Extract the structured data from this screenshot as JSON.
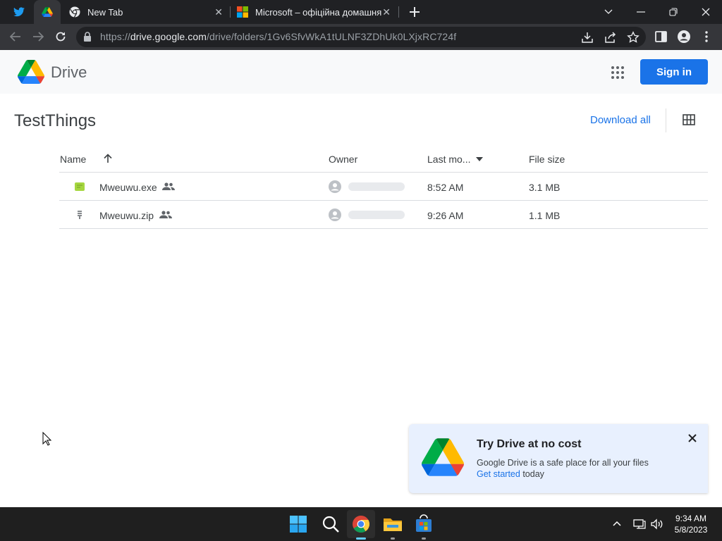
{
  "browser": {
    "tabs": [
      {
        "type": "pinned",
        "icon": "twitter-icon",
        "active": false
      },
      {
        "type": "pinned",
        "icon": "google-drive-icon",
        "active": true
      },
      {
        "type": "normal",
        "icon": "chrome-icon",
        "label": "New Tab",
        "active": false
      },
      {
        "type": "normal",
        "icon": "microsoft-logo-icon",
        "label": "Microsoft – офіційна домашня с",
        "active": false
      }
    ],
    "url_prefix": "https://",
    "url_domain": "drive.google.com",
    "url_path": "/drive/folders/1Gv6SfvWkA1tULNF3ZDhUk0LXjxRC724f",
    "close_glyph": "✕"
  },
  "drive": {
    "app_name": "Drive",
    "sign_in_label": "Sign in",
    "folder_title": "TestThings",
    "download_all_label": "Download all",
    "columns": {
      "name": "Name",
      "owner": "Owner",
      "modified": "Last mo...",
      "size": "File size"
    },
    "files": [
      {
        "name": "Mweuwu.exe",
        "icon": "executable-file-icon",
        "modified": "8:52 AM",
        "size": "3.1 MB",
        "shared": true
      },
      {
        "name": "Mweuwu.zip",
        "icon": "zip-file-icon",
        "modified": "9:26 AM",
        "size": "1.1 MB",
        "shared": true
      }
    ],
    "promo": {
      "title": "Try Drive at no cost",
      "description": "Google Drive is a safe place for all your files",
      "link_text": "Get started",
      "link_suffix": " today",
      "close_glyph": "✕"
    }
  },
  "taskbar": {
    "time": "9:34 AM",
    "date": "5/8/2023"
  },
  "colors": {
    "accent": "#1a73e8",
    "tabstrip": "#202124",
    "toolbar": "#35363a",
    "promo_bg": "#e8f0fe"
  }
}
